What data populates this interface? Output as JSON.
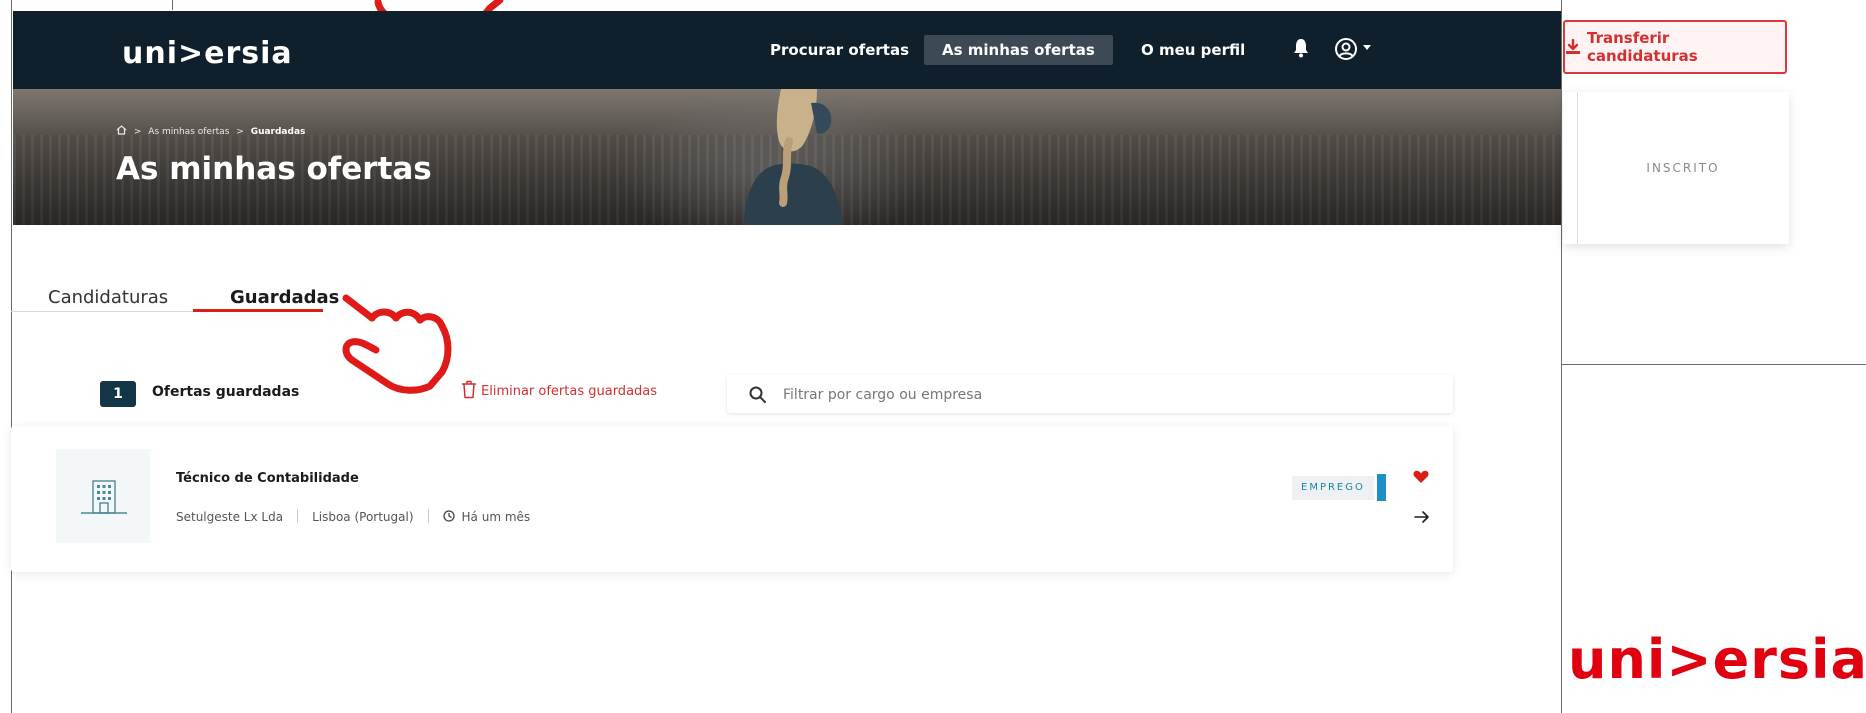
{
  "app": {
    "logo_text": "uni>ersia",
    "brand_color": "#0f1f2b",
    "accent_color": "#d91e18"
  },
  "nav": {
    "items": [
      {
        "label": "Procurar ofertas",
        "active": false
      },
      {
        "label": "As minhas ofertas",
        "active": true
      },
      {
        "label": "O meu perfil",
        "active": false
      }
    ],
    "icons": [
      "bell-icon",
      "user-circle-icon",
      "caret-down-icon"
    ]
  },
  "hero": {
    "breadcrumb": {
      "home_icon": "home-icon",
      "separator": ">",
      "level1": "As minhas ofertas",
      "current": "Guardadas"
    },
    "title": "As minhas ofertas"
  },
  "tabs": [
    {
      "label": "Candidaturas",
      "active": false
    },
    {
      "label": "Guardadas",
      "active": true
    }
  ],
  "toolbar": {
    "count": "1",
    "count_label": "Ofertas guardadas",
    "delete_label": "Eliminar ofertas guardadas",
    "search_placeholder": "Filtrar por cargo ou empresa"
  },
  "offers": [
    {
      "title": "Técnico de Contabilidade",
      "company": "Setulgeste Lx Lda",
      "location": "Lisboa (Portugal)",
      "posted": "Há um mês",
      "type": "EMPREGO",
      "favorited": true
    }
  ],
  "side": {
    "transfer_button_label": "Transferir candidaturas",
    "status_label": "INSCRITO",
    "brand_logo_text": "uni>ersia",
    "brand_logo_color": "#e0000f"
  },
  "annotations": {
    "pointer_icon": "hand-pointer-icon",
    "pointer_color": "#e01919"
  }
}
